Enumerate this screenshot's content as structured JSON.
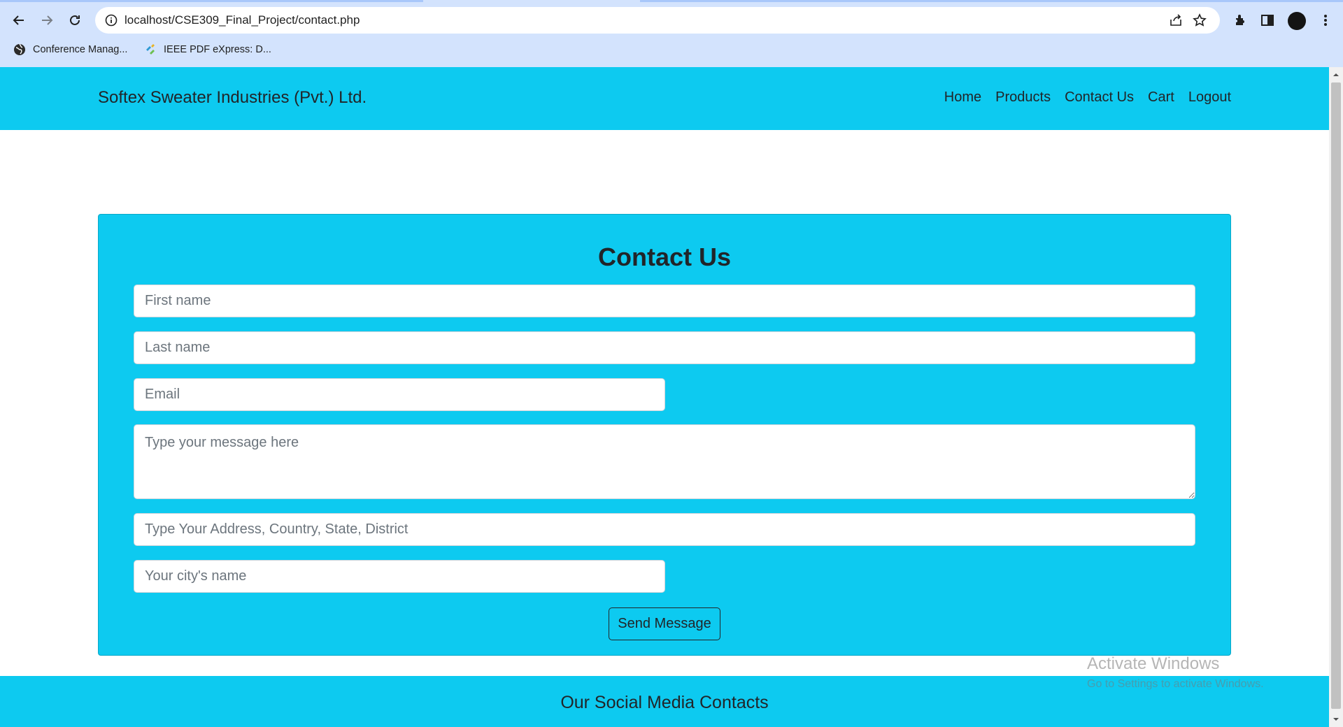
{
  "browser": {
    "url": "localhost/CSE309_Final_Project/contact.php",
    "bookmarks": [
      {
        "label": "Conference Manag...",
        "icon": "globe-icon"
      },
      {
        "label": "IEEE PDF eXpress: D...",
        "icon": "ieee-icon"
      }
    ]
  },
  "site": {
    "brand": "Softex Sweater Industries (Pvt.) Ltd.",
    "nav": [
      "Home",
      "Products",
      "Contact Us",
      "Cart",
      "Logout"
    ],
    "accent_color": "#0dcaf0"
  },
  "contact": {
    "title": "Contact Us",
    "first_name_placeholder": "First name",
    "last_name_placeholder": "Last name",
    "email_placeholder": "Email",
    "message_placeholder": "Type your message here",
    "address_placeholder": "Type Your Address, Country, State, District",
    "city_placeholder": "Your city's name",
    "submit_label": "Send Message"
  },
  "footer": {
    "title": "Our Social Media Contacts"
  },
  "watermark": {
    "line1": "Activate Windows",
    "line2": "Go to Settings to activate Windows."
  }
}
